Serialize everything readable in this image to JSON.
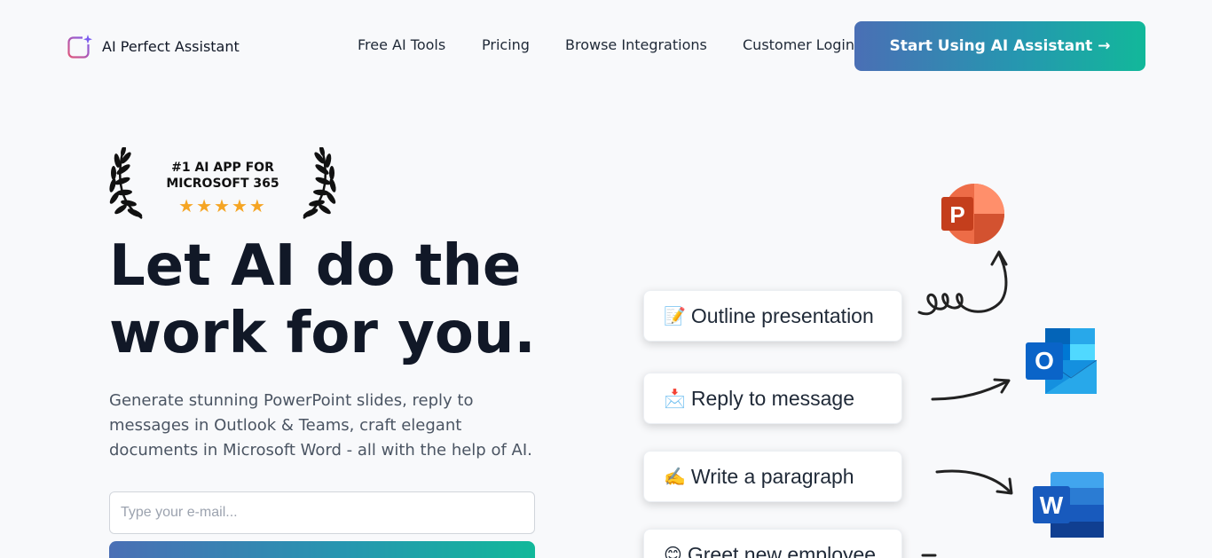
{
  "nav": {
    "brand": "AI Perfect Assistant",
    "links": [
      "Free AI Tools",
      "Pricing",
      "Browse Integrations",
      "Customer Login"
    ],
    "cta": "Start Using AI Assistant →"
  },
  "award": {
    "line1": "#1 AI APP FOR",
    "line2": "MICROSOFT 365",
    "stars": "★★★★★",
    "rating": 5
  },
  "hero": {
    "title_line1": "Let AI do the",
    "title_line2": "work for you.",
    "subtitle": "Generate stunning PowerPoint slides, reply to messages in Outlook & Teams, craft elegant documents in Microsoft Word - all with the help of AI.",
    "email_placeholder": "Type your e-mail..."
  },
  "actions": [
    {
      "emoji": "📝",
      "label": "Outline presentation",
      "app": "powerpoint-icon"
    },
    {
      "emoji": "📩",
      "label": "Reply to message",
      "app": "outlook-icon"
    },
    {
      "emoji": "✍️",
      "label": "Write a paragraph",
      "app": "word-icon"
    },
    {
      "emoji": "😊",
      "label": "Greet new employee",
      "app": "teams-icon"
    }
  ],
  "apps": {
    "powerpoint_letter": "P",
    "outlook_letter": "O",
    "word_letter": "W"
  },
  "colors": {
    "cta_gradient_start": "#4a6fb5",
    "cta_gradient_end": "#12b89a",
    "powerpoint": "#d24726",
    "outlook": "#0a64c8",
    "word": "#185abd",
    "star": "#f5a524"
  }
}
